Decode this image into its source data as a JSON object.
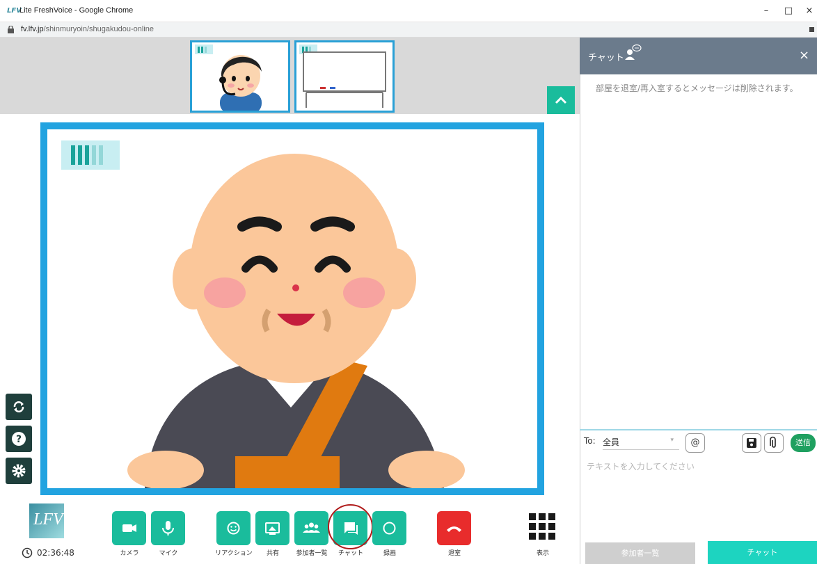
{
  "window": {
    "app_icon": "LFV",
    "title": "Lite FreshVoice - Google Chrome",
    "minimize": "–",
    "maximize": "□",
    "close": "×"
  },
  "browser": {
    "url_host": "fv.lfv.jp",
    "url_path": "/shinmuryoin/shugakudou-online"
  },
  "stage": {
    "avatar": "monk-illustration"
  },
  "thumbnails": [
    {
      "name": "user-with-headset"
    },
    {
      "name": "whiteboard"
    }
  ],
  "side_buttons": [
    "refresh-icon",
    "help-icon",
    "settings-icon"
  ],
  "footer": {
    "logo": "LFV",
    "timer": "02:36:48"
  },
  "toolbar": {
    "camera": "カメラ",
    "mic": "マイク",
    "reaction": "リアクション",
    "share": "共有",
    "participants": "参加者一覧",
    "chat": "チャット",
    "record": "録画",
    "leave": "退室",
    "display": "表示"
  },
  "chat": {
    "title": "チャット",
    "close": "×",
    "notice": "部屋を退室/再入室するとメッセージは削除されます。",
    "to_label": "To:",
    "to_value": "全員",
    "mention": "@",
    "send": "送信",
    "input_placeholder": "テキストを入力してください",
    "tab_participants": "参加者一覧",
    "tab_chat": "チャット"
  },
  "colors": {
    "accent": "#1abc9c",
    "stage_border": "#22a3e0",
    "leave": "#e82c2c",
    "chat_header": "#6b7b8c",
    "send": "#1fa060"
  }
}
